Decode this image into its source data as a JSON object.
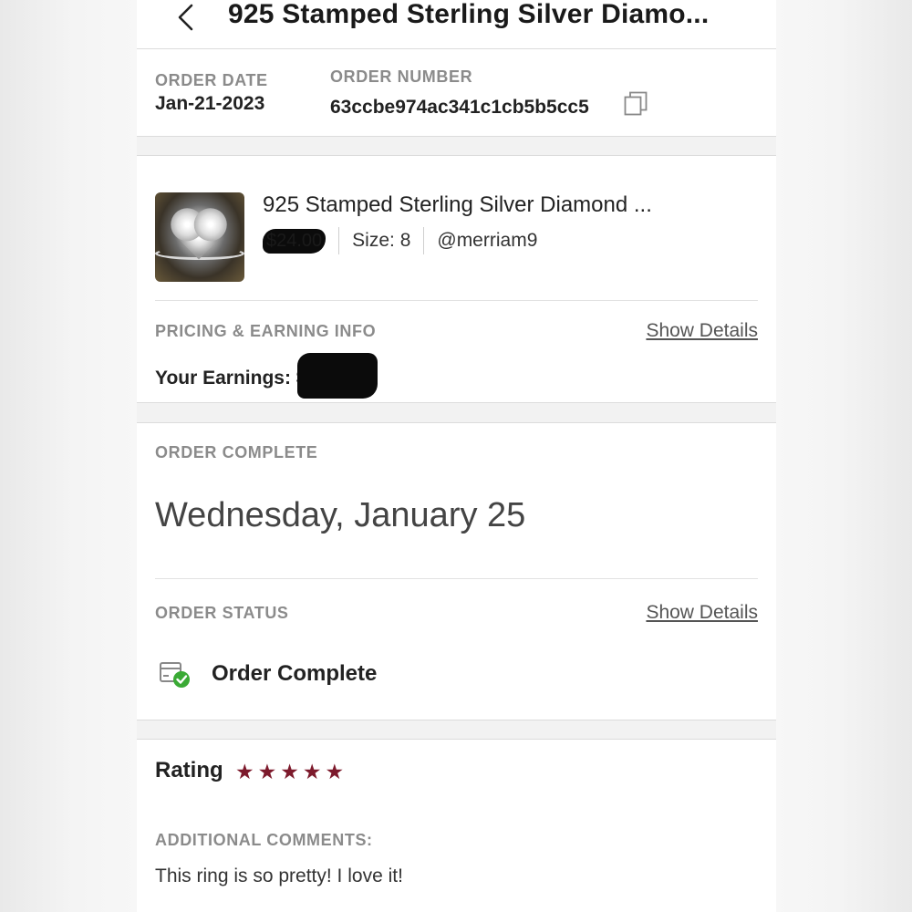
{
  "header": {
    "title": "925 Stamped Sterling Silver Diamo..."
  },
  "order_info": {
    "date_label": "ORDER DATE",
    "date_value": "Jan-21-2023",
    "number_label": "ORDER NUMBER",
    "number_value": "63ccbe974ac341c1cb5b5cc5"
  },
  "item": {
    "title": "925 Stamped Sterling Silver Diamond ...",
    "price": "$24.00",
    "size": "Size: 8",
    "seller": "@merriam9"
  },
  "pricing": {
    "label": "PRICING & EARNING INFO",
    "show_details": "Show Details",
    "earnings_label": "Your Earnings: $"
  },
  "order_complete": {
    "label": "ORDER COMPLETE",
    "date": "Wednesday, January 25"
  },
  "order_status": {
    "label": "ORDER STATUS",
    "show_details": "Show Details",
    "status": "Order Complete"
  },
  "rating": {
    "label": "Rating",
    "stars": 5,
    "star_color": "#7d1a2c",
    "comments_label": "ADDITIONAL COMMENTS:",
    "comment": "This ring is so pretty! I love it!"
  }
}
